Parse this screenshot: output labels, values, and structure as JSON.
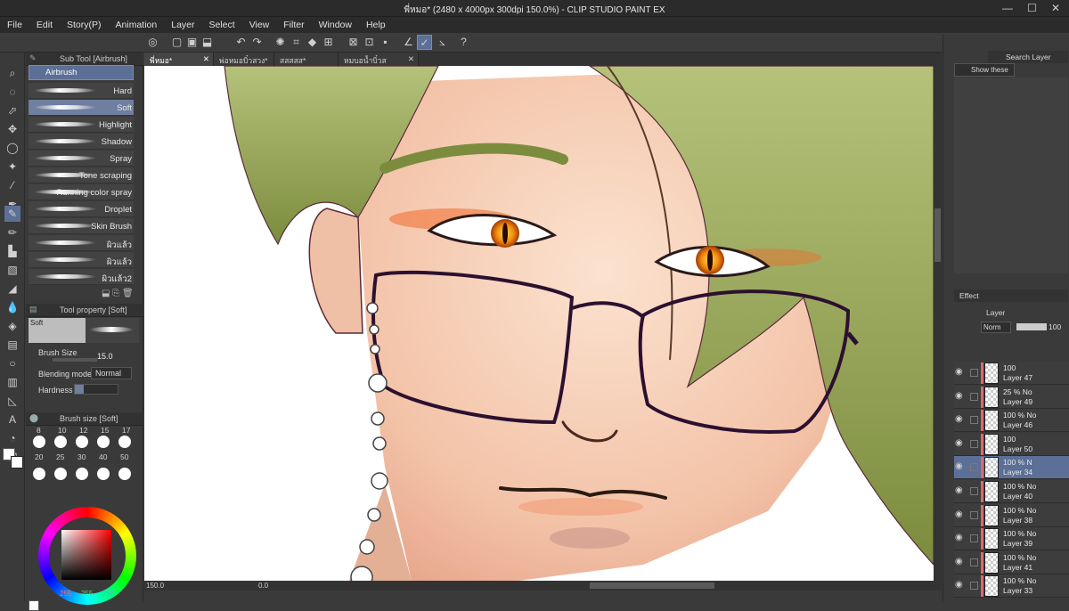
{
  "window": {
    "title": "พี่หมอ* (2480 x 4000px 300dpi 150.0%)  - CLIP STUDIO PAINT EX",
    "min": "—",
    "max": "☐",
    "close": "✕"
  },
  "menu": [
    "File",
    "Edit",
    "Story(P)",
    "Animation",
    "Layer",
    "Select",
    "View",
    "Filter",
    "Window",
    "Help"
  ],
  "subtool": {
    "header": "Sub Tool [Airbrush]",
    "group": "Airbrush",
    "brushes": [
      "Hard",
      "Soft",
      "Highlight",
      "Shadow",
      "Spray",
      "Tone scraping",
      "Running color spray",
      "Droplet",
      "Skin Brush",
      "ผิวแล้ว",
      "ผิวแล้ว",
      "ผิวแล้ว2"
    ]
  },
  "toolprop": {
    "header": "Tool property [Soft]",
    "preset": "Soft",
    "brush_size_label": "Brush Size",
    "brush_size_value": "15.0",
    "blend_label": "Blending mode",
    "blend_value": "Normal",
    "hardness_label": "Hardness"
  },
  "brushsize": {
    "header": "Brush size [Soft]",
    "top_values": [
      "8",
      "10",
      "12",
      "15",
      "17"
    ],
    "labels_row1": [
      "20",
      "25",
      "30",
      "40",
      "50"
    ]
  },
  "color": {
    "r": "255",
    "g": "255",
    "b": "255"
  },
  "tabs": [
    {
      "label": "พี่หมอ*",
      "active": true
    },
    {
      "label": "พ่อหมอบิ๋วสวง*",
      "active": false
    },
    {
      "label": "สสสสส*",
      "active": false
    },
    {
      "label": "หมบอน้ำบิ๋วส",
      "active": false
    }
  ],
  "status": {
    "zoom": "150.0",
    "angle": "0.0"
  },
  "search": {
    "header": "Search Layer",
    "filter": "Show these"
  },
  "effect": {
    "label": "Effect"
  },
  "layerpanel": {
    "tab_label": "Layer",
    "blend": "Norm",
    "opacity": "100"
  },
  "layers": [
    {
      "op": "100",
      "name": "Layer 47",
      "sel": false
    },
    {
      "op": "25 % No",
      "name": "Layer 49",
      "sel": false
    },
    {
      "op": "100 % No",
      "name": "Layer 46",
      "sel": false
    },
    {
      "op": "100",
      "name": "Layer 50",
      "sel": false
    },
    {
      "op": "100 % N",
      "name": "Layer 34",
      "sel": true
    },
    {
      "op": "100 % No",
      "name": "Layer 40",
      "sel": false
    },
    {
      "op": "100 % No",
      "name": "Layer 38",
      "sel": false
    },
    {
      "op": "100 % No",
      "name": "Layer 39",
      "sel": false
    },
    {
      "op": "100 % No",
      "name": "Layer 41",
      "sel": false
    },
    {
      "op": "100 % No",
      "name": "Layer 33",
      "sel": false
    }
  ],
  "colors": {
    "accent": "#5c6f96",
    "panel": "#3a3a3a",
    "hair": "#8fa04e",
    "iris": "#f2a010"
  }
}
